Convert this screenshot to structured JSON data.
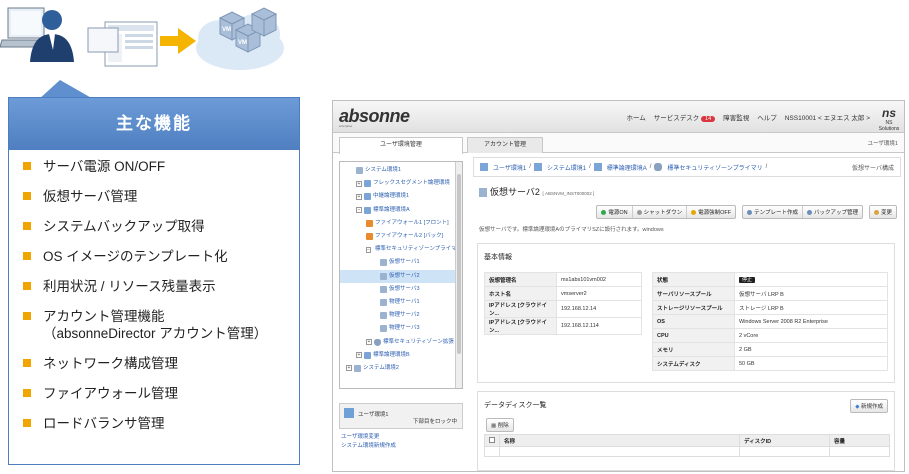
{
  "features": {
    "title": "主な機能",
    "items": [
      "サーバ電源 ON/OFF",
      "仮想サーバ管理",
      "システムバックアップ取得",
      "OS イメージのテンプレート化",
      "利用状況 / リソース残量表示",
      "アカウント管理機能",
      "（absonneDirector アカウント管理）",
      "ネットワーク構成管理",
      "ファイアウォール管理",
      "ロードバランサ管理"
    ]
  },
  "illustration": {
    "vm_label": "VM"
  },
  "app": {
    "logo": "absonne",
    "logo_sub": "enterprise",
    "nav": [
      "ホーム",
      "サービスデスク",
      "障害監視",
      "ヘルプ"
    ],
    "nav_badge": "14",
    "user": "NSS10001 < エヌエス 太郎 >",
    "corp_mark": "ns",
    "corp_name": "NS Solutions",
    "tabs": [
      "ユーザ環境管理",
      "アカウント管理"
    ],
    "tabs_right": "ユーザ環境1",
    "tree": [
      {
        "label": "システム環境1",
        "icon": "srv",
        "indent": 16
      },
      {
        "label": "フレックスセグメント論理環境",
        "icon": "blue",
        "indent": 16,
        "toggle": "+"
      },
      {
        "label": "中継論理環境1",
        "icon": "blue",
        "indent": 16,
        "toggle": "+"
      },
      {
        "label": "標準論理環境A",
        "icon": "blue",
        "indent": 16,
        "toggle": "−"
      },
      {
        "label": "ファイアウォール1 [フロント]",
        "icon": "orange",
        "indent": 26
      },
      {
        "label": "ファイアウォール2 [バック]",
        "icon": "orange",
        "indent": 26
      },
      {
        "label": "標準セキュリティゾーンプライマリ",
        "icon": "shield",
        "indent": 26,
        "toggle": "−"
      },
      {
        "label": "仮想サーバ1",
        "icon": "srv",
        "indent": 40
      },
      {
        "label": "仮想サーバ2",
        "icon": "srv",
        "indent": 40,
        "selected": true
      },
      {
        "label": "仮想サーバ3",
        "icon": "srv",
        "indent": 40
      },
      {
        "label": "物理サーバ1",
        "icon": "srv",
        "indent": 40
      },
      {
        "label": "物理サーバ2",
        "icon": "srv",
        "indent": 40
      },
      {
        "label": "物理サーバ3",
        "icon": "srv",
        "indent": 40
      },
      {
        "label": "標準セキュリティゾーン拡張",
        "icon": "shield",
        "indent": 26,
        "toggle": "+"
      },
      {
        "label": "標準論理環境B",
        "icon": "blue",
        "indent": 16,
        "toggle": "+"
      },
      {
        "label": "システム環境2",
        "icon": "srv",
        "indent": 6,
        "toggle": "+"
      }
    ],
    "userbox": {
      "name": "ユーザ環境1",
      "lock": "下部目をロック中"
    },
    "links": [
      "ユーザ環境変更",
      "システム環境新規作成"
    ],
    "breadcrumb": [
      "ユーザ環境1",
      "システム環境1",
      "標準論理環境A",
      "標準セキュリティゾーンプライマリ"
    ],
    "breadcrumb_right": "仮想サーバ構成",
    "title": "仮想サーバ2",
    "title_id": "[ ABSNVM_INST000002 ]",
    "buttons_power": [
      "電源ON",
      "シャットダウン",
      "電源強制OFF"
    ],
    "buttons_mgmt": [
      "テンプレート作成",
      "バックアップ管理"
    ],
    "button_edit": "変更",
    "description": "仮想サーバです。標準論理環境AのプライマリSZに設行されます。windows",
    "basic_title": "基本情報",
    "left_info": [
      {
        "k": "仮想管理名",
        "v": "ms1abs101vm002"
      },
      {
        "k": "ホスト名",
        "v": "vmserver2"
      },
      {
        "k": "IPアドレス [クラウドイン...",
        "v": "192.168.12.14"
      },
      {
        "k": "IPアドレス [クラウドイン...",
        "v": "192.168.12.114"
      }
    ],
    "right_info": [
      {
        "k": "状態",
        "v": "停止",
        "tag": true
      },
      {
        "k": "サーバリソースプール",
        "v": "仮想サーバ LRP B"
      },
      {
        "k": "ストレージリソースプール",
        "v": "ストレージ LRP B"
      },
      {
        "k": "OS",
        "v": "Windows Server 2008 R2 Enterprise"
      },
      {
        "k": "CPU",
        "v": "2 vCore"
      },
      {
        "k": "メモリ",
        "v": "2 GB"
      },
      {
        "k": "システムディスク",
        "v": "50 GB"
      }
    ],
    "disk_title": "データディスク一覧",
    "new_button": "新規作成",
    "delete_button": "削除",
    "disk_columns": [
      "",
      "名称",
      "ディスクID",
      "容量"
    ]
  }
}
